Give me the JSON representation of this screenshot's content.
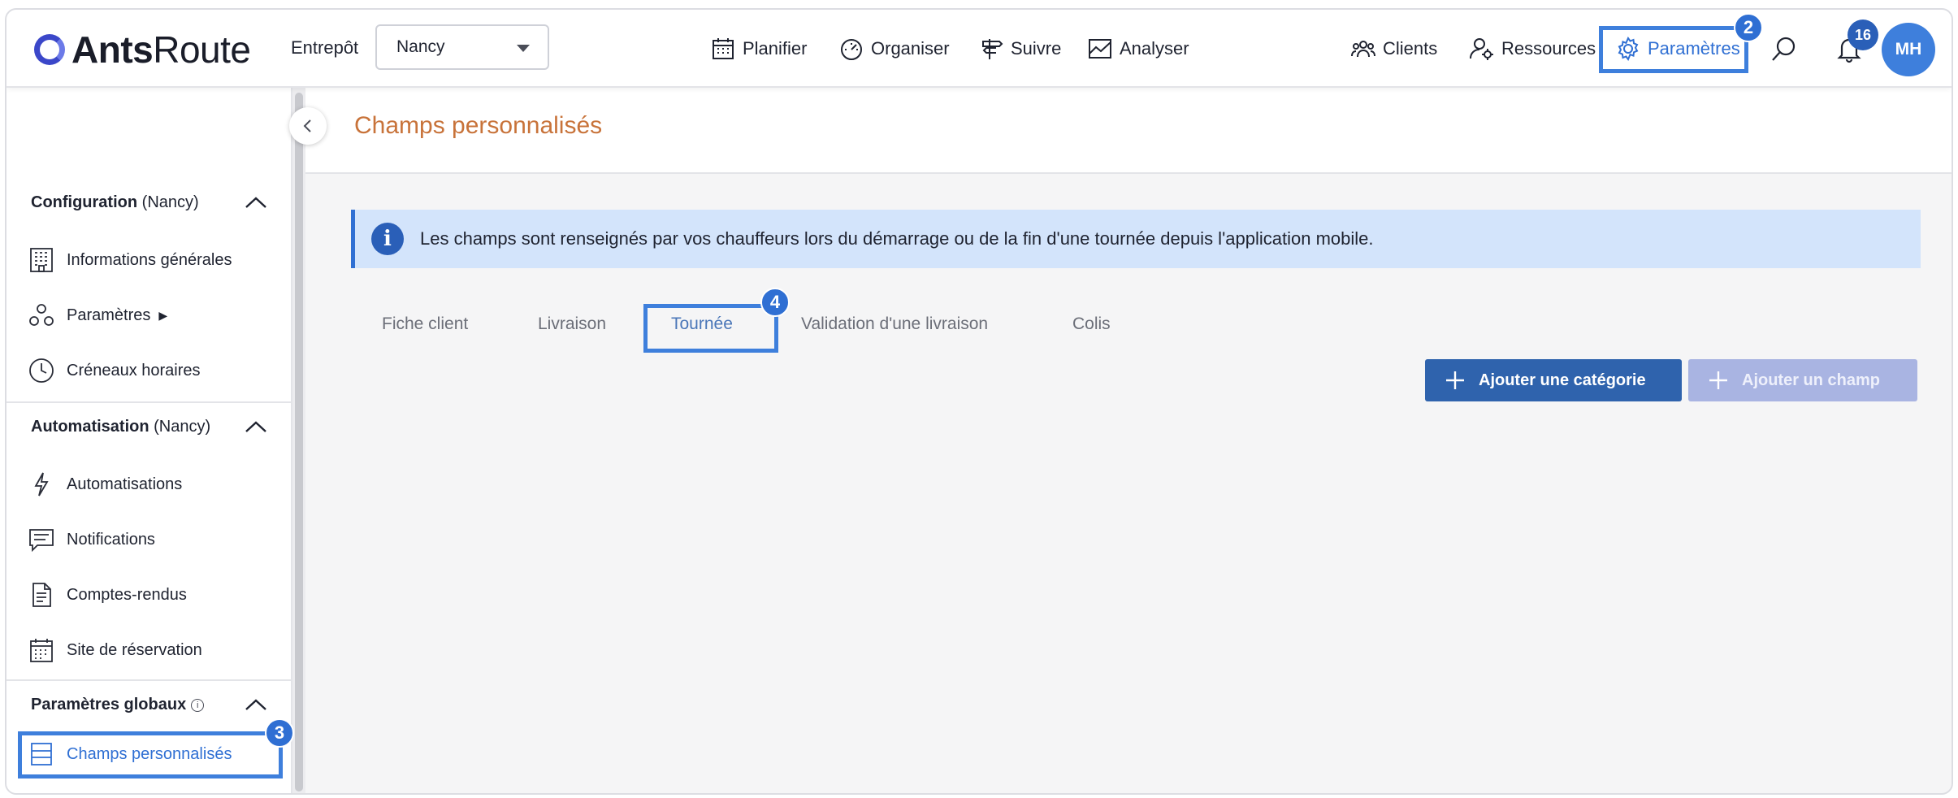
{
  "brand": {
    "name_bold": "Ants",
    "name_light": "Route"
  },
  "warehouse": {
    "label": "Entrepôt",
    "selected": "Nancy"
  },
  "nav": {
    "items": [
      {
        "label": "Planifier",
        "icon": "calendar-icon"
      },
      {
        "label": "Organiser",
        "icon": "speedometer-icon"
      },
      {
        "label": "Suivre",
        "icon": "signpost-icon"
      },
      {
        "label": "Analyser",
        "icon": "chart-icon"
      },
      {
        "label": "Clients",
        "icon": "users-icon"
      },
      {
        "label": "Ressources",
        "icon": "user-gear-icon"
      },
      {
        "label": "Paramètres",
        "icon": "gear-icon"
      }
    ],
    "notification_count": "16",
    "avatar_initials": "MH"
  },
  "step_badges": {
    "params": "2",
    "sidebar": "3",
    "tab": "4"
  },
  "sidebar": {
    "sections": [
      {
        "title": "Configuration",
        "suffix": "(Nancy)"
      },
      {
        "title": "Automatisation",
        "suffix": "(Nancy)"
      },
      {
        "title": "Paramètres globaux",
        "suffix": ""
      }
    ],
    "items": [
      {
        "label": "Informations générales"
      },
      {
        "label": "Paramètres"
      },
      {
        "label": "Créneaux horaires"
      },
      {
        "label": "Automatisations"
      },
      {
        "label": "Notifications"
      },
      {
        "label": "Comptes-rendus"
      },
      {
        "label": "Site de réservation"
      },
      {
        "label": "Champs personnalisés"
      }
    ]
  },
  "page": {
    "title": "Champs personnalisés",
    "info": "Les champs sont renseignés par vos chauffeurs lors du démarrage ou de la fin d'une tournée depuis l'application mobile."
  },
  "tabs": [
    {
      "label": "Fiche client"
    },
    {
      "label": "Livraison"
    },
    {
      "label": "Tournée"
    },
    {
      "label": "Validation d'une livraison"
    },
    {
      "label": "Colis"
    }
  ],
  "actions": {
    "add_category": "Ajouter une catégorie",
    "add_field": "Ajouter un champ"
  },
  "colors": {
    "accent": "#2f6fd3",
    "title": "#c8733a",
    "primary_button": "#2f63ad",
    "disabled_button": "#a9b4e2",
    "banner": "#d3e4fb"
  }
}
